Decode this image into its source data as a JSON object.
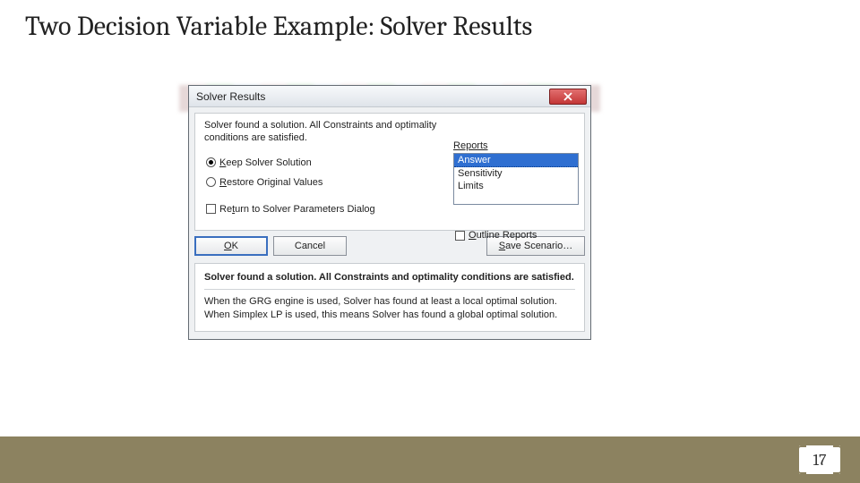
{
  "slide": {
    "title": "Two Decision Variable Example: Solver Results",
    "page_number": "17"
  },
  "dialog": {
    "title": "Solver Results",
    "status_message": "Solver found a solution. All Constraints and optimality conditions are satisfied.",
    "radio_keep": "Keep Solver Solution",
    "radio_restore": "Restore Original Values",
    "check_return": "Return to Solver Parameters Dialog",
    "check_outline": "Outline Reports",
    "reports_label": "Reports",
    "reports": [
      "Answer",
      "Sensitivity",
      "Limits"
    ],
    "selected_report_index": 0,
    "ok": "OK",
    "cancel": "Cancel",
    "save_scenario": "Save Scenario…",
    "explain_heading": "Solver found a solution. All Constraints and optimality conditions are satisfied.",
    "explain_body": "When the GRG engine is used, Solver has found at least a local optimal solution. When Simplex LP is used, this means Solver has found a global optimal solution."
  }
}
